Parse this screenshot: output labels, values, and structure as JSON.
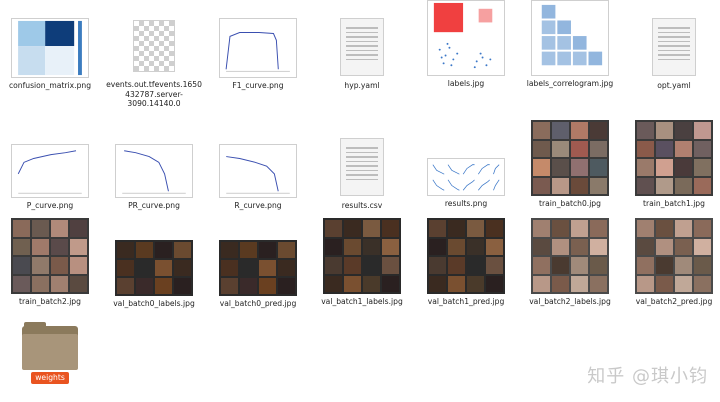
{
  "files": [
    {
      "name": "confusion_matrix.png"
    },
    {
      "name": "events.out.tfevents.1650432787.server-3090.14140.0"
    },
    {
      "name": "F1_curve.png"
    },
    {
      "name": "hyp.yaml"
    },
    {
      "name": "labels.jpg"
    },
    {
      "name": "labels_correlogram.jpg"
    },
    {
      "name": "opt.yaml"
    },
    {
      "name": "P_curve.png"
    },
    {
      "name": "PR_curve.png"
    },
    {
      "name": "R_curve.png"
    },
    {
      "name": "results.csv"
    },
    {
      "name": "results.png"
    },
    {
      "name": "train_batch0.jpg"
    },
    {
      "name": "train_batch1.jpg"
    },
    {
      "name": "train_batch2.jpg"
    },
    {
      "name": "val_batch0_labels.jpg"
    },
    {
      "name": "val_batch0_pred.jpg"
    },
    {
      "name": "val_batch1_labels.jpg"
    },
    {
      "name": "val_batch1_pred.jpg"
    },
    {
      "name": "val_batch2_labels.jpg"
    },
    {
      "name": "val_batch2_pred.jpg"
    },
    {
      "name": "weights"
    }
  ],
  "watermark": "知乎 @琪小钧",
  "colors": {
    "selection": "#e95420",
    "folder": "#a8957a"
  }
}
